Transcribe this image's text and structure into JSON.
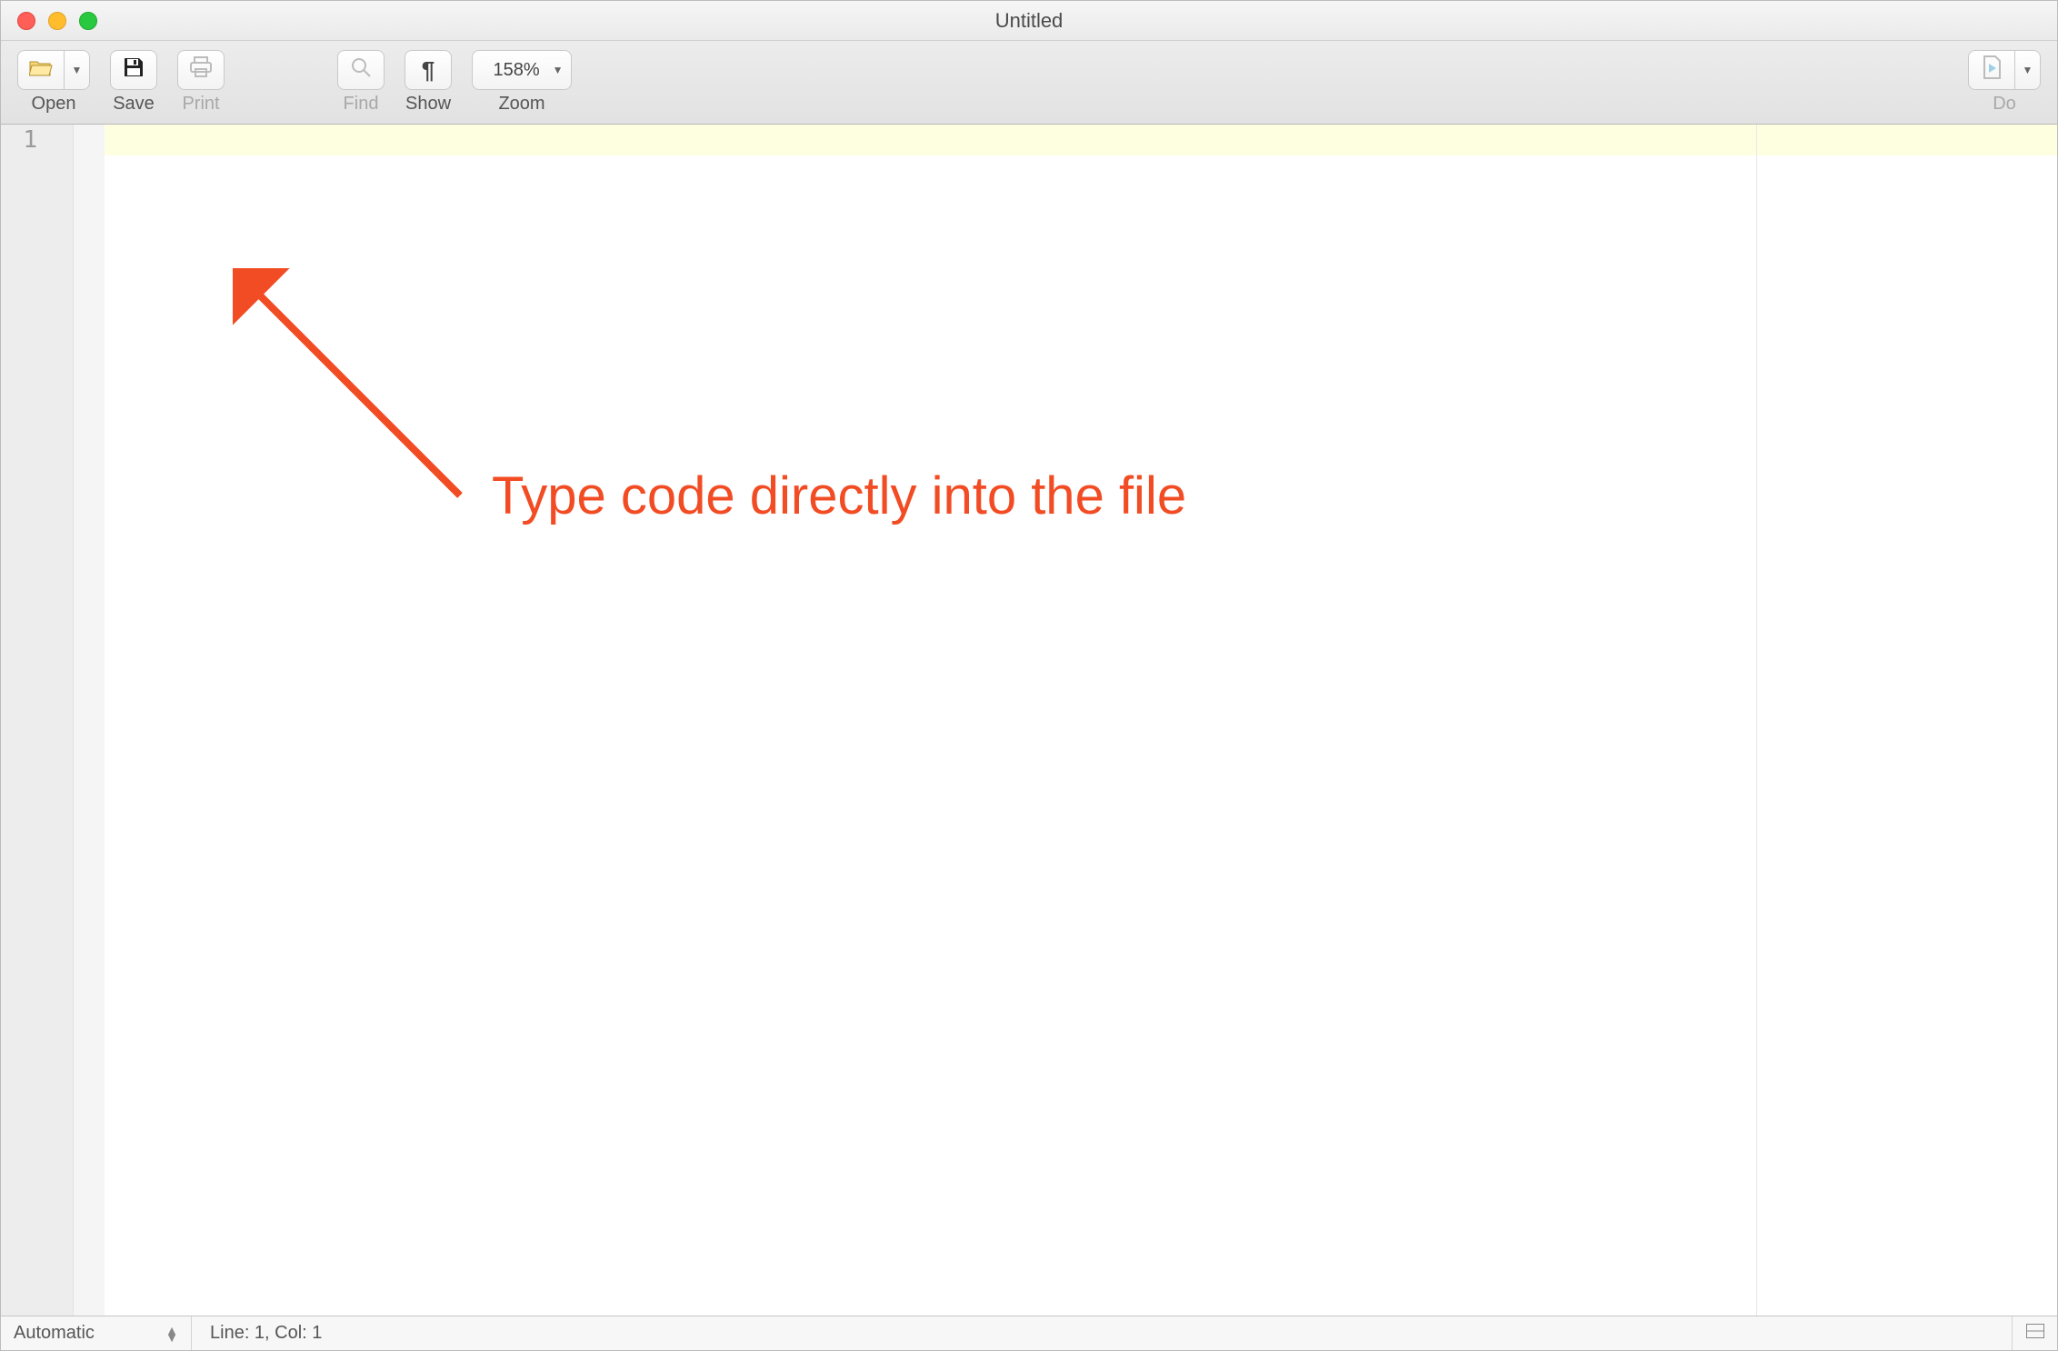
{
  "window": {
    "title": "Untitled"
  },
  "toolbar": {
    "open": {
      "label": "Open"
    },
    "save": {
      "label": "Save"
    },
    "print": {
      "label": "Print"
    },
    "find": {
      "label": "Find"
    },
    "show": {
      "label": "Show"
    },
    "zoom": {
      "label": "Zoom",
      "value": "158%"
    },
    "do": {
      "label": "Do"
    }
  },
  "editor": {
    "line_numbers": [
      "1"
    ]
  },
  "annotation": {
    "text": "Type code directly into the file",
    "color": "#f24c24"
  },
  "statusbar": {
    "language": "Automatic",
    "position": "Line: 1, Col: 1"
  }
}
